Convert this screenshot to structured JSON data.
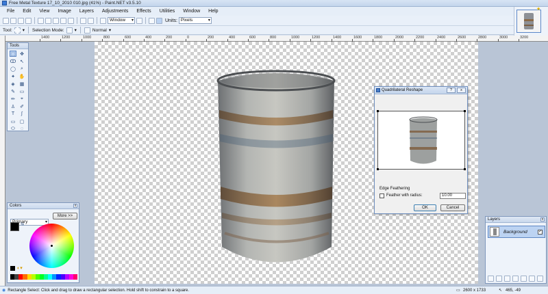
{
  "window": {
    "title": "Free Metal Texture 17_10_2010 010.jpg (41%) - Paint.NET v3.5.10"
  },
  "menu": [
    "File",
    "Edit",
    "View",
    "Image",
    "Layers",
    "Adjustments",
    "Effects",
    "Utilities",
    "Window",
    "Help"
  ],
  "toolbar": {
    "zoom_label": "Window",
    "units_label": "Units:",
    "units_value": "Pixels"
  },
  "toolbar2": {
    "tool_label": "Tool:",
    "selection_mode_label": "Selection Mode:",
    "blend_mode": "Normal"
  },
  "ruler": {
    "labels": [
      "1400",
      "1200",
      "1000",
      "800",
      "600",
      "400",
      "200",
      "0",
      "200",
      "400",
      "600",
      "800",
      "1000",
      "1200",
      "1400",
      "1600",
      "1800",
      "2000",
      "2200",
      "2400",
      "2600",
      "2800",
      "3000",
      "3200"
    ]
  },
  "panels": {
    "tools_title": "Tools",
    "colors_title": "Colors",
    "colors_mode": "Primary",
    "colors_more": "More >>",
    "layers_title": "Layers",
    "layer_name": "Background"
  },
  "dialog": {
    "title": "Quadrilateral Reshape",
    "edge_label": "Edge Feathering",
    "feather_label": "Feather with radius:",
    "feather_value": "10.00",
    "ok": "OK",
    "cancel": "Cancel"
  },
  "status": {
    "message": "Rectangle Select: Click and drag to draw a rectangular selection. Hold shift to constrain to a square.",
    "size": "2600 x 1733",
    "coords": "465, -49"
  },
  "colors": {
    "accent": "#3b7ad6",
    "canvas_checker": "#cfcfcf",
    "workspace": "#b9c5d6"
  }
}
